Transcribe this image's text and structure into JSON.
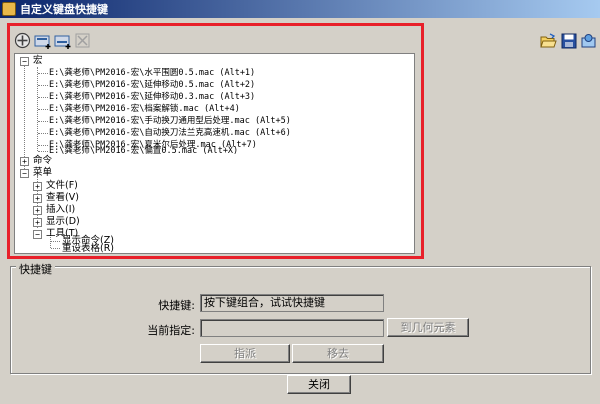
{
  "window": {
    "title": "自定义键盘快捷键"
  },
  "toolbar": {
    "left_icons": [
      "add-icon",
      "new-key-icon",
      "insert-key-icon",
      "delete-icon"
    ],
    "right_icons": [
      "open-folder-icon",
      "save-icon",
      "reset-icon"
    ]
  },
  "tree": {
    "macro": {
      "label": "宏",
      "items": [
        "E:\\龚老师\\PM2016-宏\\水平围圆0.5.mac (Alt+1)",
        "E:\\龚老师\\PM2016-宏\\延伸移动0.5.mac (Alt+2)",
        "E:\\龚老师\\PM2016-宏\\延伸移动0.3.mac (Alt+3)",
        "E:\\龚老师\\PM2016-宏\\档案解锁.mac (Alt+4)",
        "E:\\龚老师\\PM2016-宏\\手动换刀通用型后处理.mac (Alt+5)",
        "E:\\龚老师\\PM2016-宏\\自动换刀法兰克高速机.mac (Alt+6)",
        "E:\\龚老师\\PM2016-宏\\夏米尔后处理.mac (Alt+7)",
        "E:\\龚老师\\PM2016-宏\\偏置0.5.mac (Alt+X)"
      ]
    },
    "command": {
      "label": "命令"
    },
    "menu": {
      "label": "菜单",
      "items": [
        "文件(F)",
        "查看(V)",
        "插入(I)",
        "显示(D)",
        "工具(T)"
      ],
      "tools_children": [
        "显示命令(Z)",
        "重设表格(R)"
      ]
    }
  },
  "shortcut": {
    "group_label": "快捷键",
    "shortcut_label": "快捷键:",
    "shortcut_value": "按下键组合，试试快捷键",
    "current_label": "当前指定:",
    "current_value": "",
    "goto_button": "到几何元素",
    "assign_button": "指派",
    "remove_button": "移去"
  },
  "footer": {
    "close_button": "关闭"
  },
  "colors": {
    "highlight": "#e8202a",
    "titlebar": "#0a246a"
  }
}
